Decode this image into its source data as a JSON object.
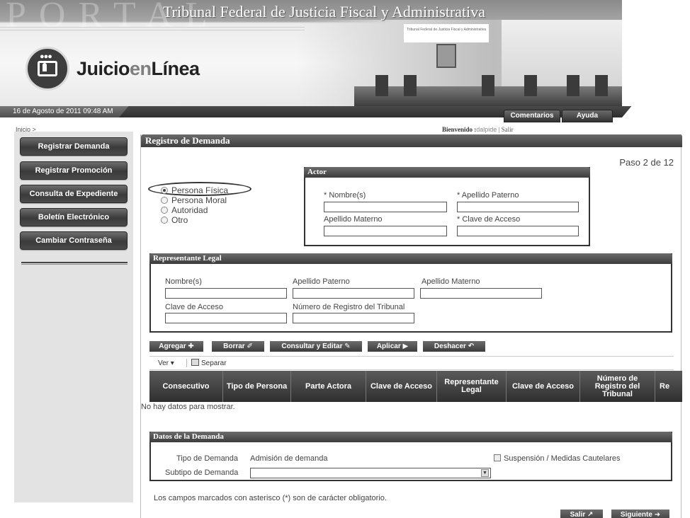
{
  "header": {
    "title": "Tribunal Federal de Justicia Fiscal y Administrativa",
    "watermark": "PORTAL",
    "logo_part1": "Juicio",
    "logo_part2": "en",
    "logo_part3": "Línea",
    "date": "16 de Agosto de 2011 09:48 AM",
    "comentarios_label": "Comentarios",
    "ayuda_label": "Ayuda"
  },
  "breadcrumb": "Inicio >",
  "welcome": {
    "label": "Bienvenido :",
    "user": "dalpide",
    "separator": " | ",
    "logout": "Salir"
  },
  "sidebar": {
    "items": [
      {
        "label": "Registrar Demanda"
      },
      {
        "label": "Registrar Promoción"
      },
      {
        "label": "Consulta de Expediente"
      },
      {
        "label": "Boletín Electrónico"
      },
      {
        "label": "Cambiar Contraseña"
      }
    ]
  },
  "main": {
    "title": "Registro de Demanda",
    "step": "Paso 2 de 12",
    "person_types": [
      {
        "label": "Persona Física",
        "selected": true
      },
      {
        "label": "Persona Moral",
        "selected": false
      },
      {
        "label": "Autoridad",
        "selected": false
      },
      {
        "label": "Otro",
        "selected": false
      }
    ],
    "actor": {
      "title": "Actor",
      "nombre": "* Nombre(s)",
      "apellido_paterno": "* Apellido Paterno",
      "apellido_materno": "Apellido Materno",
      "clave_acceso": "* Clave de Acceso"
    },
    "representante": {
      "title": "Representante Legal",
      "nombre": "Nombre(s)",
      "apellido_paterno": "Apellido Paterno",
      "apellido_materno": "Apellido Materno",
      "clave_acceso": "Clave de Acceso",
      "numero_registro": "Número de Registro del Tribunal"
    },
    "toolbar": {
      "agregar": "Agregar ✚",
      "borrar": "Borrar ✐",
      "consultar": "Consultar y Editar ✎",
      "aplicar": "Aplicar ▶",
      "deshacer": "Deshacer ↶",
      "ver": "Ver ▾",
      "separar": "Separar"
    },
    "grid": {
      "columns": [
        "Consecutivo",
        "Tipo de Persona",
        "Parte Actora",
        "Clave de Acceso",
        "Representante Legal",
        "Clave de Acceso",
        "Número de Registro del Tribunal",
        "Re"
      ],
      "empty": "No hay datos para mostrar."
    },
    "demanda": {
      "title": "Datos de la Demanda",
      "tipo_label": "Tipo de Demanda",
      "tipo_value": "Admisión de demanda",
      "subtipo_label": "Subtipo de Demanda",
      "subtipo_value": "",
      "suspension": "Suspensión / Medidas Cautelares"
    },
    "notice": "Los campos marcados con asterisco (*) son de carácter obligatorio.",
    "salir": "Salir ↗",
    "siguiente": "Siguiente ➜"
  }
}
